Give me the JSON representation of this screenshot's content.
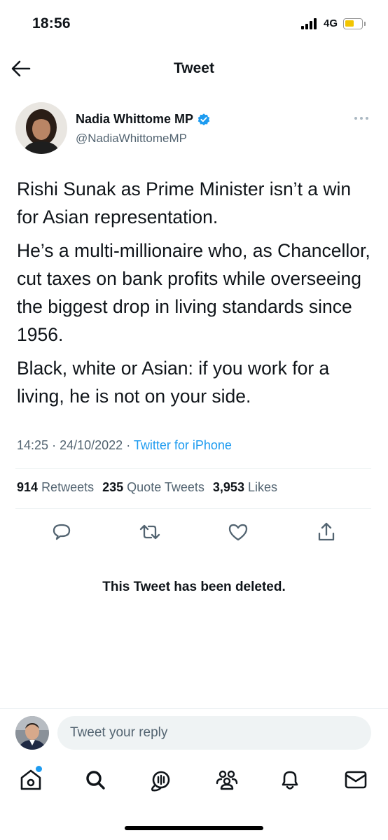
{
  "status_bar": {
    "time": "18:56",
    "network": "4G",
    "battery_level": 0.55,
    "battery_color": "#f2c500"
  },
  "header": {
    "title": "Tweet",
    "back_icon": "arrow-left-icon"
  },
  "author": {
    "name": "Nadia Whittome MP",
    "handle": "@NadiaWhittomeMP",
    "verified_icon": "verified-badge-icon",
    "verified_color": "#1d9bf0"
  },
  "tweet": {
    "paragraphs": [
      "Rishi Sunak as Prime Minister isn’t a win for Asian representation.",
      "He’s a multi-millionaire who, as Chancellor, cut taxes on bank profits while overseeing the biggest drop in living standards since 1956.",
      "Black, white or Asian: if you work for a living, he is not on your side."
    ],
    "time": "14:25",
    "date": "24/10/2022",
    "source": "Twitter for iPhone",
    "separator": "·"
  },
  "stats": {
    "retweets_count": "914",
    "retweets_label": "Retweets",
    "quotes_count": "235",
    "quotes_label": "Quote Tweets",
    "likes_count": "3,953",
    "likes_label": "Likes"
  },
  "actions": [
    "reply-icon",
    "retweet-icon",
    "like-icon",
    "share-icon"
  ],
  "deleted_notice": "This Tweet has been deleted.",
  "reply_bar": {
    "placeholder": "Tweet your reply"
  },
  "bottom_nav": [
    "home-icon",
    "search-icon",
    "spaces-icon",
    "communities-icon",
    "notifications-icon",
    "messages-icon"
  ],
  "colors": {
    "accent": "#1d9bf0",
    "text": "#0f1419",
    "secondary": "#536471"
  }
}
